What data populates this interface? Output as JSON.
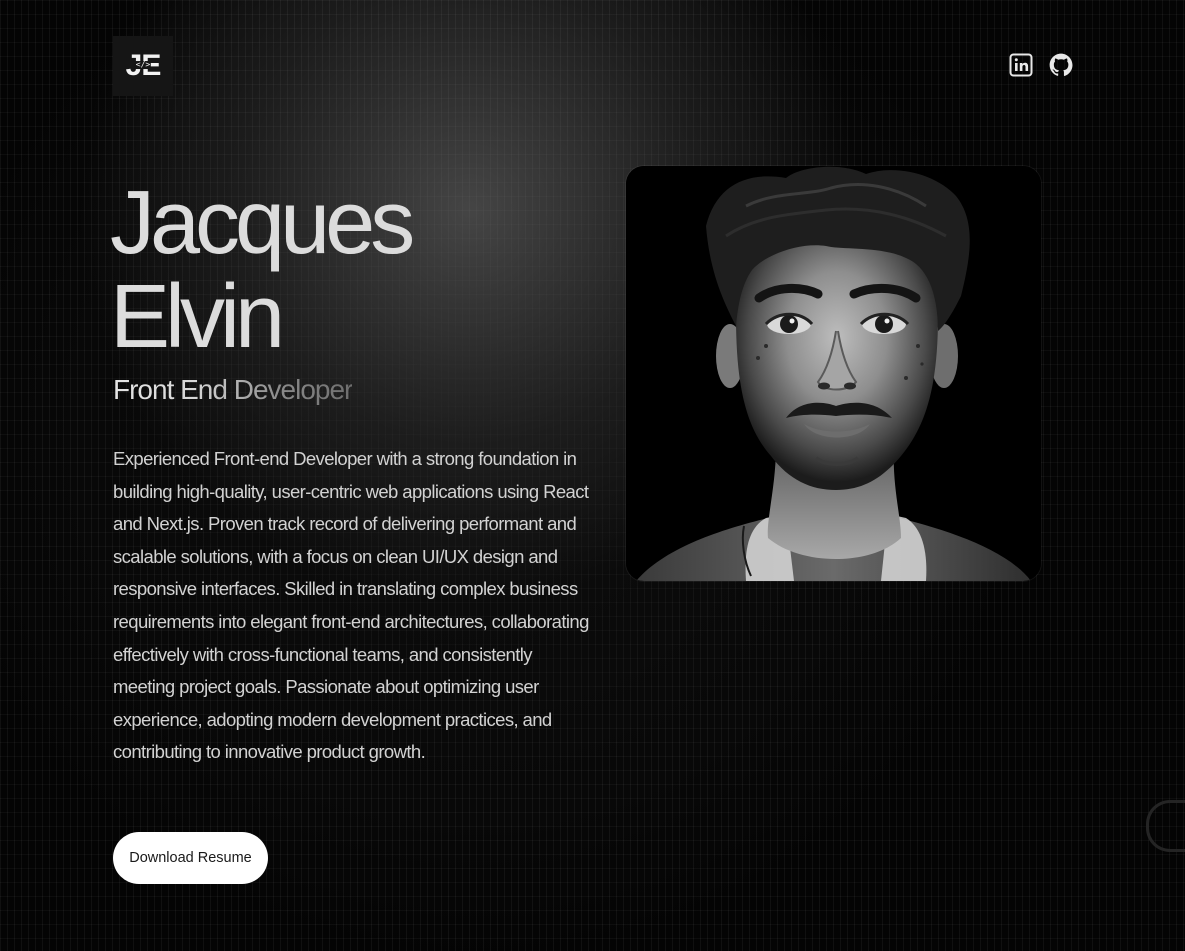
{
  "header": {
    "logo_text": "JE",
    "logo_code": "</>",
    "social_icons": [
      "linkedin-icon",
      "github-icon"
    ]
  },
  "hero": {
    "first_name": "Jacques",
    "last_name": "Elvin",
    "role": "Front End Developer",
    "bio": "Experienced Front-end Developer with a strong foundation in building high-quality, user-centric web applications using React and Next.js. Proven track record of delivering performant and scalable solutions, with a focus on clean UI/UX design and responsive interfaces. Skilled in translating complex business requirements into elegant front-end architectures, collaborating effectively with cross-functional teams, and consistently meeting project goals. Passionate about optimizing user experience, adopting modern development practices, and contributing to innovative product growth.",
    "resume_button": "Download Resume"
  },
  "colors": {
    "background": "#000000",
    "text_primary": "#dcdcdc",
    "button_bg": "#ffffff",
    "button_text": "#1a1a1a"
  }
}
